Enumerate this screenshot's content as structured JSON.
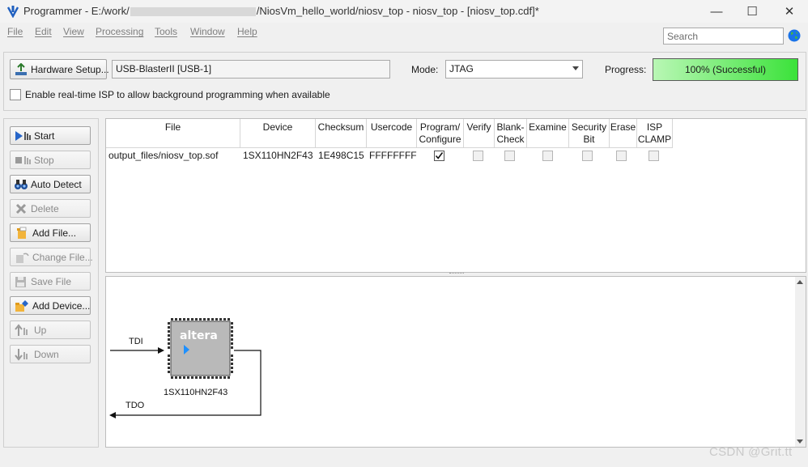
{
  "window": {
    "title_prefix": "Programmer - E:/work/",
    "title_suffix": "/NiosVm_hello_world/niosv_top - niosv_top - [niosv_top.cdf]*",
    "minimize_glyph": "—",
    "maximize_glyph": "☐",
    "close_glyph": "✕"
  },
  "menu": [
    "File",
    "Edit",
    "View",
    "Processing",
    "Tools",
    "Window",
    "Help"
  ],
  "search": {
    "placeholder": "Search",
    "value": ""
  },
  "hardware": {
    "setup_label": "Hardware Setup...",
    "device": "USB-BlasterII [USB-1]",
    "mode_label": "Mode:",
    "mode_value": "JTAG",
    "progress_label": "Progress:",
    "progress_text": "100% (Successful)",
    "progress_fraction": 1.0,
    "isp_label": "Enable real-time ISP to allow background programming when available",
    "isp_checked": false
  },
  "sidebar": {
    "start": "Start",
    "stop": "Stop",
    "auto_detect": "Auto Detect",
    "delete": "Delete",
    "add_file": "Add File...",
    "change_file": "Change File...",
    "save_file": "Save File",
    "add_device": "Add Device...",
    "up": "Up",
    "down": "Down"
  },
  "table": {
    "headers": {
      "file": "File",
      "device": "Device",
      "checksum": "Checksum",
      "usercode": "Usercode",
      "program_1": "Program/",
      "program_2": "Configure",
      "verify": "Verify",
      "blank_1": "Blank-",
      "blank_2": "Check",
      "examine": "Examine",
      "security_1": "Security",
      "security_2": "Bit",
      "erase": "Erase",
      "isp_1": "ISP",
      "isp_2": "CLAMP"
    },
    "row": {
      "file": "output_files/niosv_top.sof",
      "device": "1SX110HN2F43",
      "checksum": "1E498C15",
      "usercode": "FFFFFFFF",
      "program": true,
      "verify": false,
      "blank_check": false,
      "examine": false,
      "security_bit": false,
      "erase": false,
      "isp_clamp": false
    }
  },
  "chain": {
    "tdi": "TDI",
    "tdo": "TDO",
    "chip_logo": "altera",
    "chip_device": "1SX110HN2F43"
  },
  "watermark": "CSDN @Grit.tt",
  "colors": {
    "progress_start": "#b9f7b5",
    "progress_end": "#3be23a",
    "chip_body": "#b9b9b9",
    "chip_marker": "#1e90ff"
  }
}
